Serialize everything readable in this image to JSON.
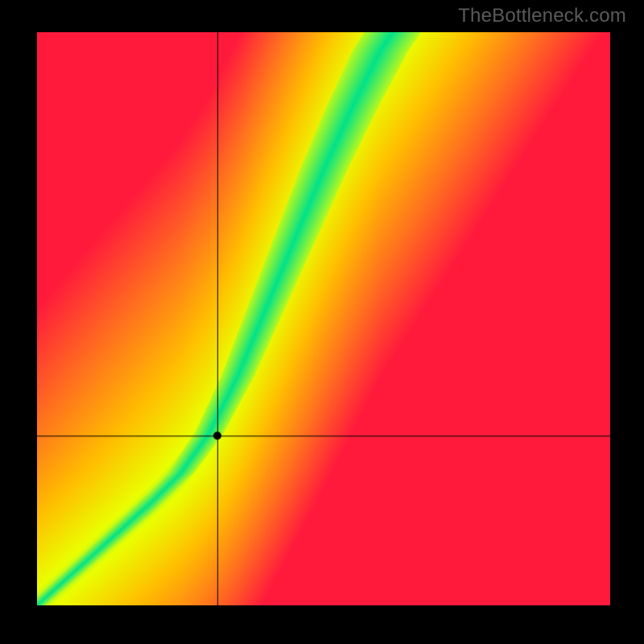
{
  "watermark": "TheBottleneck.com",
  "chart_data": {
    "type": "heatmap",
    "title": "",
    "xlabel": "",
    "ylabel": "",
    "xlim": [
      0,
      1
    ],
    "ylim": [
      0,
      1
    ],
    "crosshair": {
      "x": 0.315,
      "y": 0.295
    },
    "marker": {
      "x": 0.315,
      "y": 0.295
    },
    "ridge": {
      "description": "Green optimal band running from bottom-left corner to upper portion; lower section roughly y=x up to ~0.25, then slope steepens to ~2 (y grows twice as fast as x) so the band exits at top around x≈0.62.",
      "points": [
        {
          "x": 0.0,
          "y": 0.0
        },
        {
          "x": 0.05,
          "y": 0.045
        },
        {
          "x": 0.1,
          "y": 0.09
        },
        {
          "x": 0.15,
          "y": 0.135
        },
        {
          "x": 0.2,
          "y": 0.18
        },
        {
          "x": 0.25,
          "y": 0.23
        },
        {
          "x": 0.3,
          "y": 0.3
        },
        {
          "x": 0.35,
          "y": 0.4
        },
        {
          "x": 0.4,
          "y": 0.52
        },
        {
          "x": 0.45,
          "y": 0.64
        },
        {
          "x": 0.5,
          "y": 0.76
        },
        {
          "x": 0.55,
          "y": 0.87
        },
        {
          "x": 0.6,
          "y": 0.97
        },
        {
          "x": 0.62,
          "y": 1.0
        }
      ],
      "band_halfwidth_low": 0.015,
      "band_halfwidth_high": 0.05
    },
    "color_scale": {
      "0.0": "#00e28a",
      "0.15": "#eaff00",
      "0.4": "#ffbf00",
      "0.7": "#ff6f1f",
      "1.0": "#ff1a3c"
    }
  }
}
